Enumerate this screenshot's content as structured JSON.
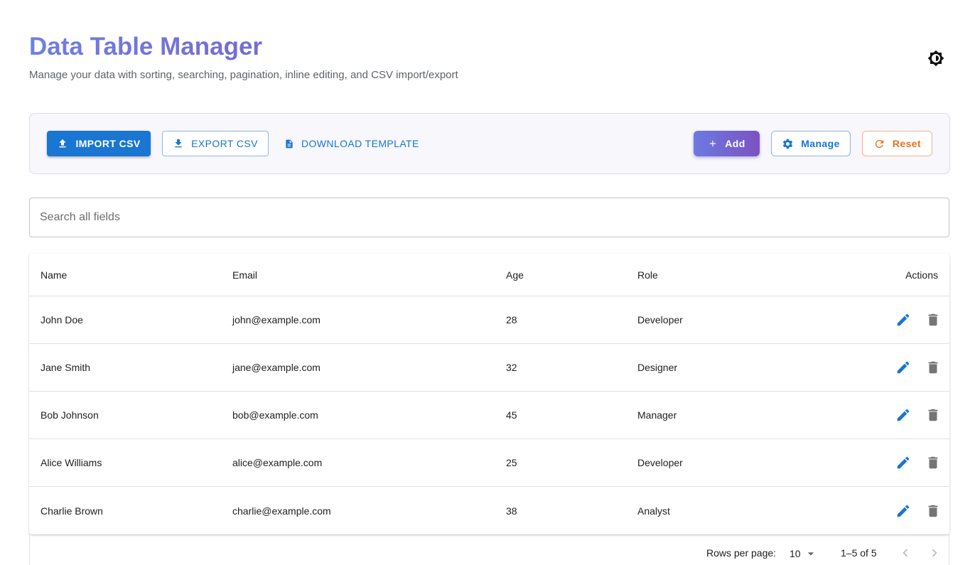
{
  "header": {
    "title": "Data Table Manager",
    "subtitle": "Manage your data with sorting, searching, pagination, inline editing, and CSV import/export"
  },
  "toolbar": {
    "import_label": "IMPORT CSV",
    "export_label": "EXPORT CSV",
    "template_label": "DOWNLOAD TEMPLATE",
    "add_label": "Add",
    "manage_label": "Manage",
    "reset_label": "Reset"
  },
  "search": {
    "placeholder": "Search all fields",
    "value": ""
  },
  "table": {
    "columns": [
      "Name",
      "Email",
      "Age",
      "Role",
      "Actions"
    ],
    "rows": [
      {
        "name": "John Doe",
        "email": "john@example.com",
        "age": "28",
        "role": "Developer"
      },
      {
        "name": "Jane Smith",
        "email": "jane@example.com",
        "age": "32",
        "role": "Designer"
      },
      {
        "name": "Bob Johnson",
        "email": "bob@example.com",
        "age": "45",
        "role": "Manager"
      },
      {
        "name": "Alice Williams",
        "email": "alice@example.com",
        "age": "25",
        "role": "Developer"
      },
      {
        "name": "Charlie Brown",
        "email": "charlie@example.com",
        "age": "38",
        "role": "Analyst"
      }
    ]
  },
  "pagination": {
    "rows_per_page_label": "Rows per page:",
    "rows_per_page_value": "10",
    "range_label": "1–5 of 5"
  },
  "colors": {
    "primary": "#1976d2",
    "accent_gradient_start": "#6c7ae0",
    "accent_gradient_end": "#7b52c2",
    "reset": "#e8711f",
    "delete_icon": "#757575"
  },
  "icons": {
    "theme": "brightness-icon",
    "import": "upload-icon",
    "export": "download-icon",
    "template": "file-icon",
    "add": "plus-icon",
    "manage": "gear-icon",
    "reset": "refresh-icon",
    "edit": "pencil-icon",
    "delete": "trash-icon"
  }
}
